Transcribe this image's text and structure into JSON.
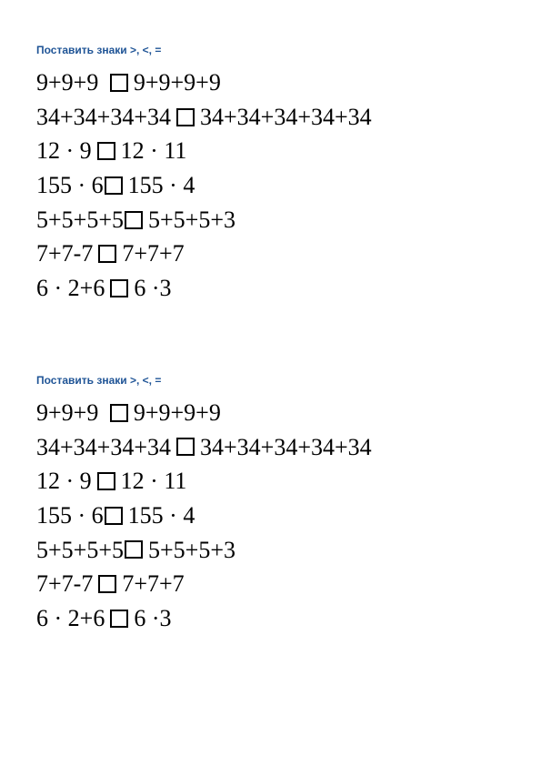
{
  "title": "Поставить знаки >, <, =",
  "problems": [
    {
      "left": "9+9+9",
      "right": "9+9+9+9",
      "gap": "wide",
      "boxSpacing": "normal"
    },
    {
      "left": "34+34+34+34",
      "right": "34+34+34+34+34",
      "gap": "normal",
      "boxSpacing": "normal"
    },
    {
      "left": "12 · 9",
      "right": "12 · 11",
      "gap": "normal",
      "boxSpacing": "normal"
    },
    {
      "left": "155 · 6",
      "right": "155 · 4",
      "gap": "normal",
      "boxSpacing": "tight"
    },
    {
      "left": "5+5+5+5",
      "right": "5+5+5+3",
      "gap": "normal",
      "boxSpacing": "tight"
    },
    {
      "left": "7+7-7",
      "right": "7+7+7",
      "gap": "normal",
      "boxSpacing": "normal"
    },
    {
      "left": "6 · 2+6",
      "right": "6 ·3",
      "gap": "normal",
      "boxSpacing": "normal"
    }
  ],
  "repeat": 2
}
